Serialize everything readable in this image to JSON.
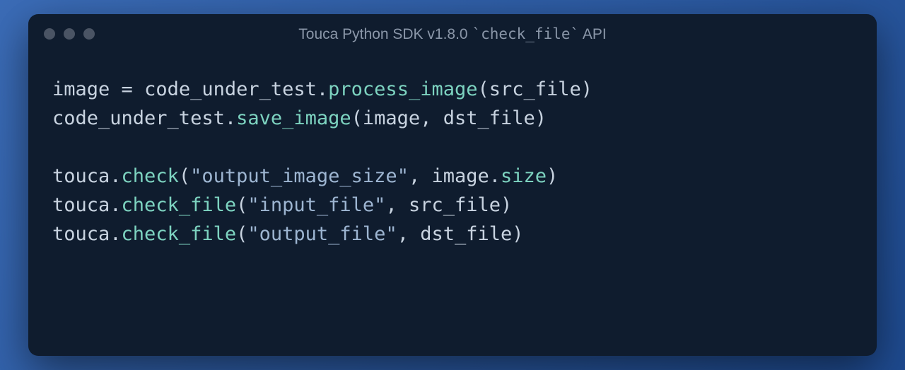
{
  "title": {
    "prefix": "Touca Python SDK v1.8.0 ",
    "code": "`check_file`",
    "suffix": " API"
  },
  "colors": {
    "background": "#0f1c2e",
    "func": "#7dd3c0",
    "string": "#9db5d1",
    "default": "#c8d3e0"
  },
  "code": {
    "lines": [
      [
        {
          "t": "image ",
          "c": "default"
        },
        {
          "t": "=",
          "c": "operator"
        },
        {
          "t": " code_under_test.",
          "c": "default"
        },
        {
          "t": "process_image",
          "c": "func"
        },
        {
          "t": "(src_file)",
          "c": "default"
        }
      ],
      [
        {
          "t": "code_under_test.",
          "c": "default"
        },
        {
          "t": "save_image",
          "c": "func"
        },
        {
          "t": "(image, dst_file)",
          "c": "default"
        }
      ],
      [],
      [
        {
          "t": "touca.",
          "c": "default"
        },
        {
          "t": "check",
          "c": "func"
        },
        {
          "t": "(",
          "c": "default"
        },
        {
          "t": "\"output_image_size\"",
          "c": "string"
        },
        {
          "t": ", image.",
          "c": "default"
        },
        {
          "t": "size",
          "c": "func"
        },
        {
          "t": ")",
          "c": "default"
        }
      ],
      [
        {
          "t": "touca.",
          "c": "default"
        },
        {
          "t": "check_file",
          "c": "func"
        },
        {
          "t": "(",
          "c": "default"
        },
        {
          "t": "\"input_file\"",
          "c": "string"
        },
        {
          "t": ", src_file)",
          "c": "default"
        }
      ],
      [
        {
          "t": "touca.",
          "c": "default"
        },
        {
          "t": "check_file",
          "c": "func"
        },
        {
          "t": "(",
          "c": "default"
        },
        {
          "t": "\"output_file\"",
          "c": "string"
        },
        {
          "t": ", dst_file)",
          "c": "default"
        }
      ]
    ]
  }
}
